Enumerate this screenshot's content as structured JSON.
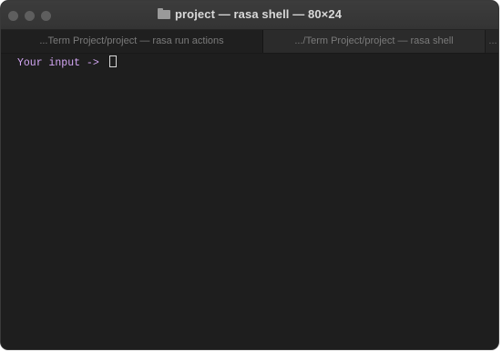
{
  "window": {
    "title": "project — rasa shell — 80×24"
  },
  "tabs": [
    {
      "label": "...Term Project/project — rasa run actions"
    },
    {
      "label": ".../Term Project/project — rasa shell"
    },
    {
      "label": "..."
    }
  ],
  "terminal": {
    "prompt": "Your input ->",
    "input_value": ""
  },
  "icons": {
    "title_icon": "folder-icon",
    "cursor": "block-cursor"
  },
  "colors": {
    "prompt_text": "#d4a7f5",
    "terminal_bg": "#1e1e1e"
  }
}
